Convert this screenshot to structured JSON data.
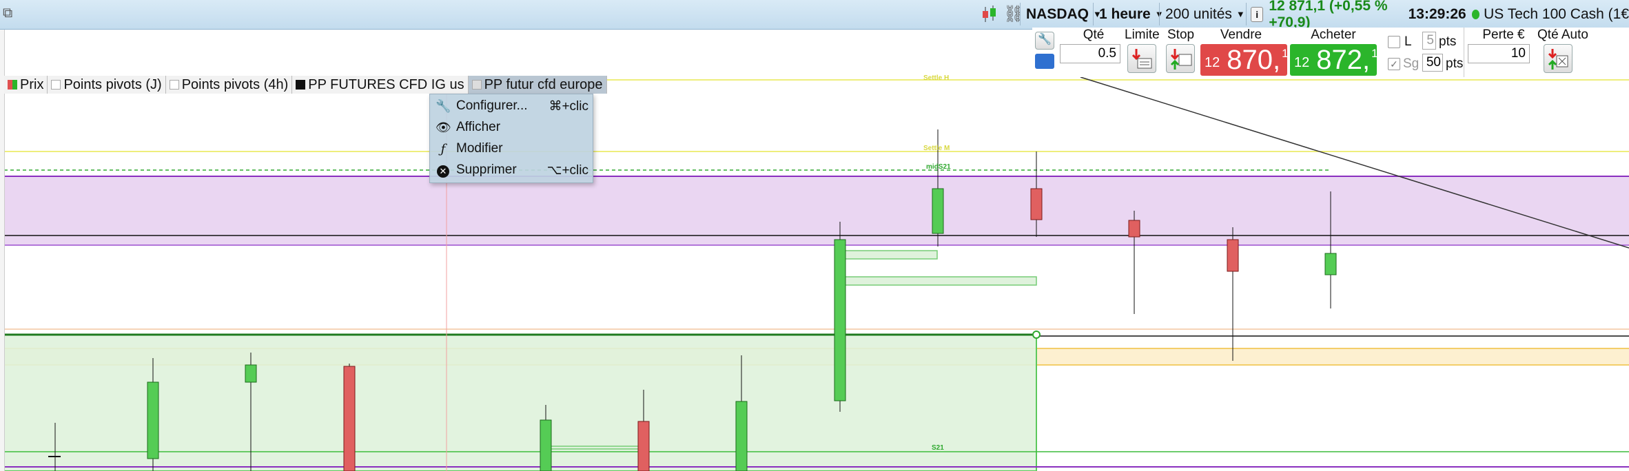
{
  "topbar": {
    "market": "NASDAQ",
    "timeframe": "1 heure",
    "units": "200 unités",
    "info_icon": "info-icon",
    "quote": "12 871,1 (+0,55 % +70,9)",
    "time": "13:29:26",
    "instrument": "US Tech 100 Cash (1€"
  },
  "order_panel": {
    "qty_label": "Qté",
    "qty_value": "0.5",
    "limit_label": "Limite",
    "stop_label": "Stop",
    "sell_label": "Vendre",
    "buy_label": "Acheter",
    "sell_prefix": "12",
    "sell_big": "870,",
    "sell_sup": "1",
    "buy_prefix": "12",
    "buy_big": "872,",
    "buy_sup": "1",
    "l_label": "L",
    "l_value": "5",
    "l_unit": "pts",
    "sg_label": "Sg",
    "sg_value": "50",
    "sg_unit": "pts",
    "loss_label": "Perte €",
    "loss_value": "10",
    "auto_qty_label": "Qté Auto",
    "colors": {
      "sell": "#e04848",
      "buy": "#2bb52b"
    }
  },
  "legend": [
    {
      "label": "Prix",
      "swatch": "#e05050"
    },
    {
      "label": "Points pivots (J)",
      "swatch": "#ffffff"
    },
    {
      "label": "Points pivots (4h)",
      "swatch": "#ffffff"
    },
    {
      "label": "PP FUTURES CFD IG us",
      "swatch": "#111111"
    },
    {
      "label": "PP futur cfd europe",
      "swatch": "#dddddd"
    }
  ],
  "context_menu": [
    {
      "icon": "wrench-icon",
      "label": "Configurer...",
      "shortcut": "⌘+clic"
    },
    {
      "icon": "eye-icon",
      "label": "Afficher",
      "shortcut": ""
    },
    {
      "icon": "function-icon",
      "label": "Modifier",
      "shortcut": ""
    },
    {
      "icon": "delete-icon",
      "label": "Supprimer",
      "shortcut": "⌥+clic"
    }
  ],
  "chart": {
    "labels": {
      "s1": "Settle H",
      "s2": "Settle M",
      "mid": "midS21",
      "s21": "S21"
    },
    "colors": {
      "up": "#55cc55",
      "down": "#e06060",
      "band_purple": "#ead6f2",
      "band_green": "#dff2dc",
      "band_orange": "#fdf0d0"
    }
  }
}
